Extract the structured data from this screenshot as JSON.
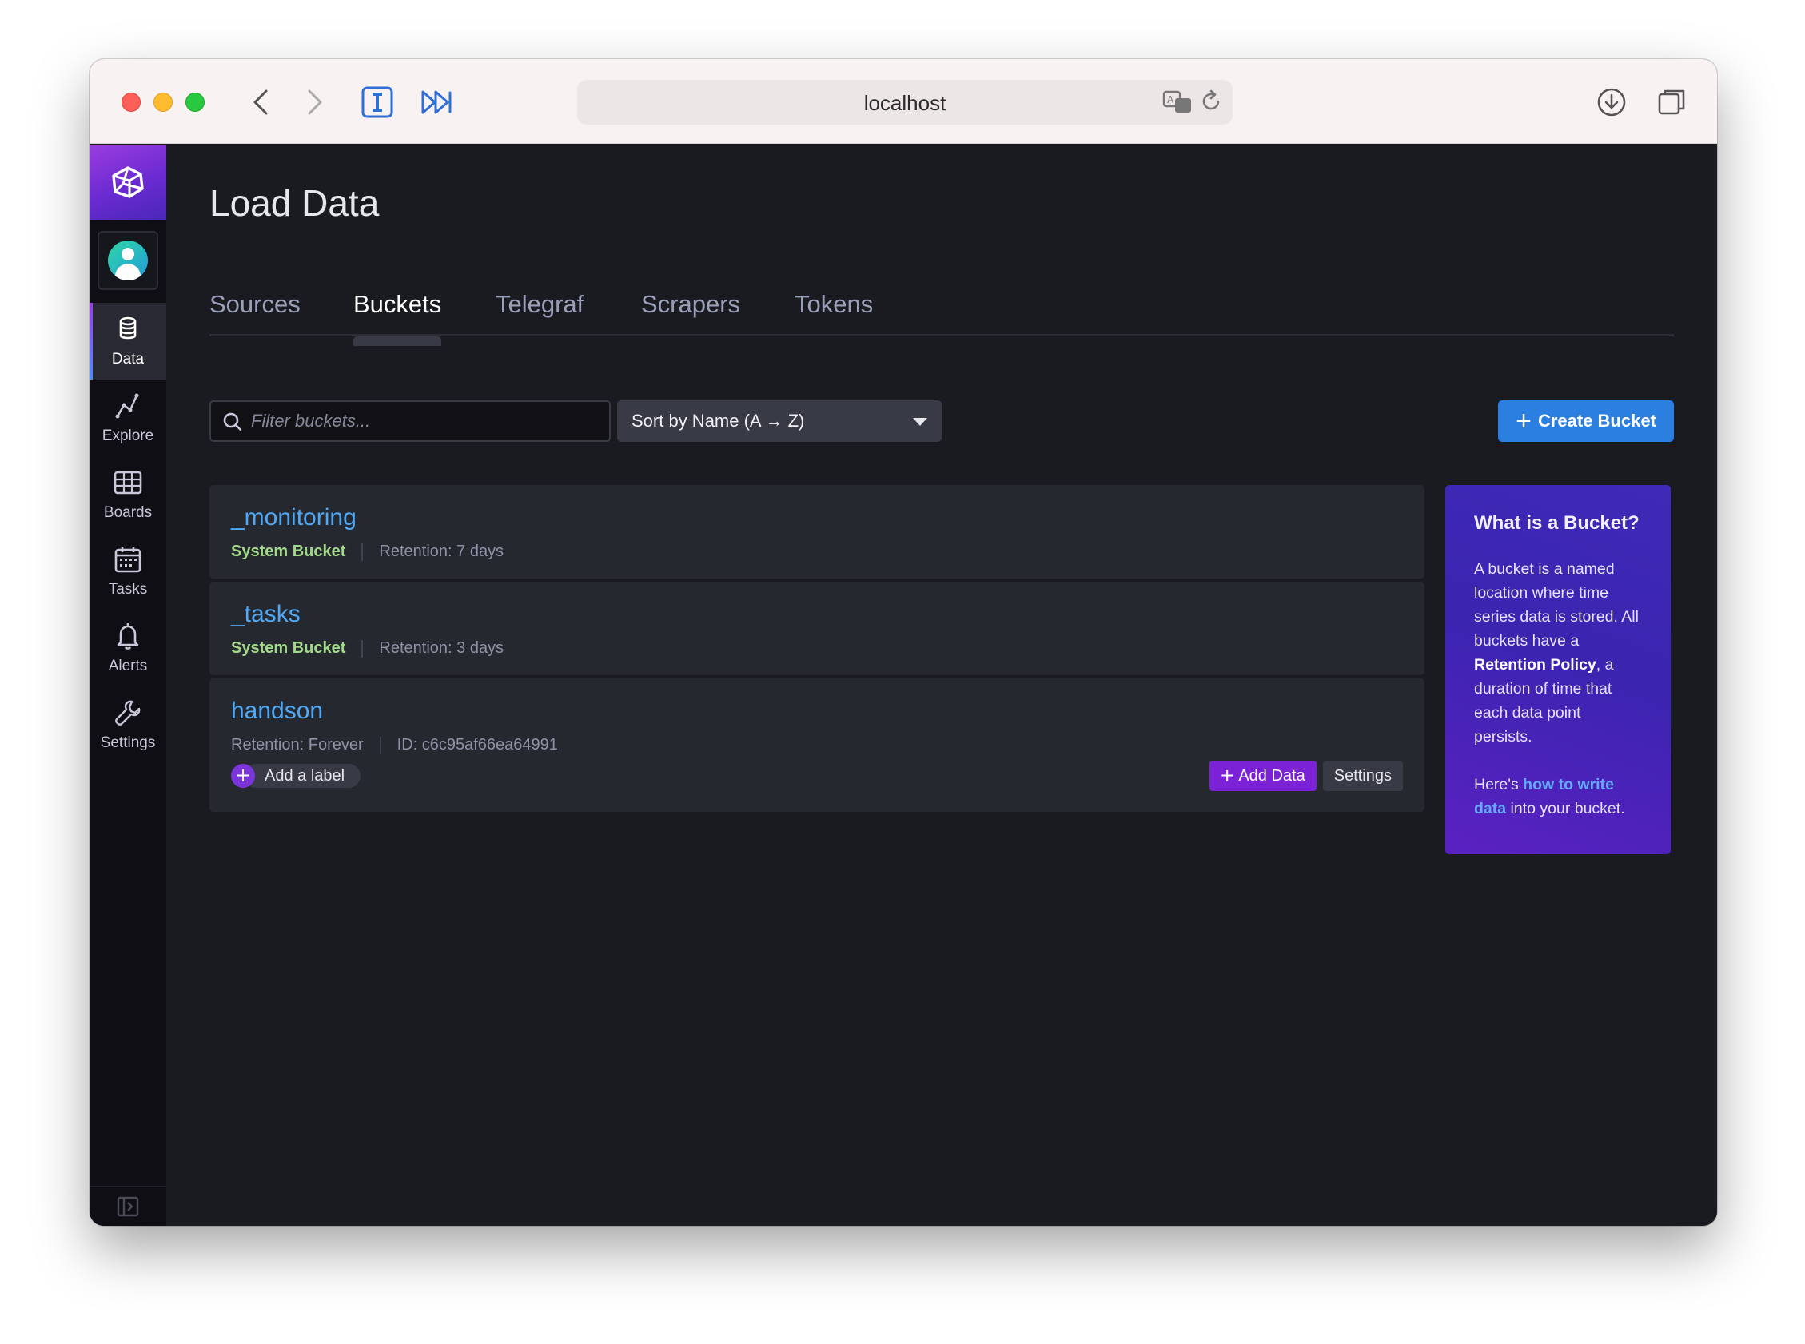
{
  "browser": {
    "url": "localhost"
  },
  "sidebar": {
    "items": [
      {
        "label": "Data",
        "icon": "database-icon",
        "active": true
      },
      {
        "label": "Explore",
        "icon": "graph-icon"
      },
      {
        "label": "Boards",
        "icon": "dashboards-icon"
      },
      {
        "label": "Tasks",
        "icon": "calendar-icon"
      },
      {
        "label": "Alerts",
        "icon": "bell-icon"
      },
      {
        "label": "Settings",
        "icon": "wrench-icon"
      }
    ]
  },
  "page": {
    "title": "Load Data"
  },
  "tabs": [
    {
      "label": "Sources"
    },
    {
      "label": "Buckets",
      "active": true
    },
    {
      "label": "Telegraf"
    },
    {
      "label": "Scrapers"
    },
    {
      "label": "Tokens"
    }
  ],
  "toolbar": {
    "filter_placeholder": "Filter buckets...",
    "sort_label": "Sort by Name (A → Z)",
    "create_label": "Create Bucket"
  },
  "buckets": [
    {
      "name": "_monitoring",
      "type": "System Bucket",
      "retention": "Retention: 7 days"
    },
    {
      "name": "_tasks",
      "type": "System Bucket",
      "retention": "Retention: 3 days"
    },
    {
      "name": "handson",
      "retention": "Retention: Forever",
      "id": "ID: c6c95af66ea64991",
      "add_label": "Add a label",
      "add_data_label": "Add Data",
      "settings_label": "Settings"
    }
  ],
  "info": {
    "title": "What is a Bucket?",
    "body_1": "A bucket is a named location where time series data is stored. All buckets have a ",
    "body_bold": "Retention Policy",
    "body_2": ", a duration of time that each data point persists.",
    "foot_1": "Here's ",
    "foot_link": "how to write data",
    "foot_2": " into your bucket."
  },
  "colors": {
    "accent_blue": "#2a7fe0",
    "link_blue": "#4fa8f5",
    "system_green": "#a3d98a",
    "purple": "#7b21d6"
  }
}
